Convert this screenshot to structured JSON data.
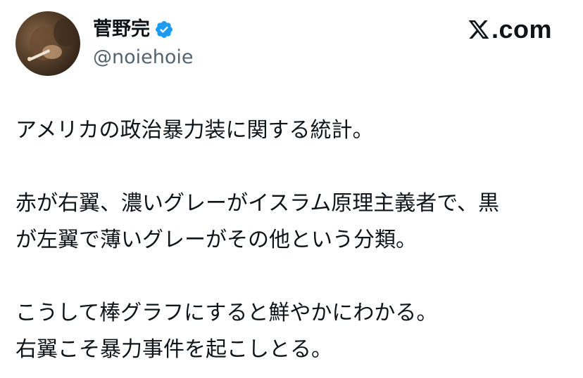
{
  "author": {
    "display_name": "菅野完",
    "handle": "@noiehoie",
    "verified": true,
    "avatar_icon": "profile-photo-avatar",
    "verified_icon": "verified-badge-icon"
  },
  "brand": {
    "logo_icon": "x-logo-icon",
    "text": ".com",
    "verified_color": "#1d9bf0"
  },
  "tweet": {
    "lines": [
      "アメリカの政治暴力装に関する統計。",
      "",
      "赤が右翼、濃いグレーがイスラム原理主義者で、黒",
      "が左翼で薄いグレーがその他という分類。",
      "",
      "こうして棒グラフにすると鮮やかにわかる。",
      "右翼こそ暴力事件を起こしとる。"
    ]
  }
}
